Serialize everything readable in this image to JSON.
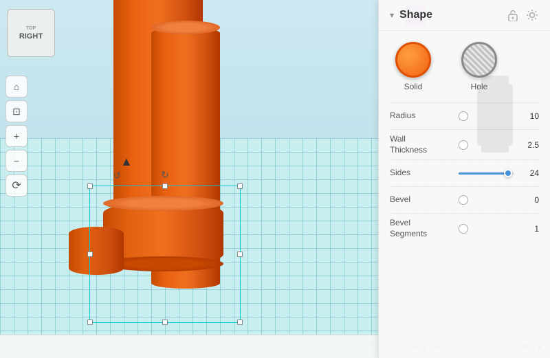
{
  "viewport": {
    "background_color": "#b8dde0"
  },
  "navcube": {
    "face_label": "RIGHT",
    "top_label": "TOP"
  },
  "toolbar": {
    "tools": [
      {
        "name": "home",
        "icon": "⌂"
      },
      {
        "name": "zoom-fit",
        "icon": "⊡"
      },
      {
        "name": "zoom-in",
        "icon": "+"
      },
      {
        "name": "zoom-out",
        "icon": "−"
      },
      {
        "name": "orbit",
        "icon": "↻"
      }
    ]
  },
  "bottom_bar": {
    "edit_grid_label": "Edit Grid",
    "snap_grid_label": "Snap Grid",
    "snap_grid_value": "0.5 mm ▴"
  },
  "right_panel": {
    "title": "Shape",
    "collapse_icon": "▾",
    "lock_icon": "🔓",
    "light_icon": "💡",
    "solid_label": "Solid",
    "hole_label": "Hole",
    "properties": [
      {
        "label": "Radius",
        "value": "10",
        "has_radio": true,
        "has_slider": false
      },
      {
        "label": "Wall\nThickness",
        "value": "2.5",
        "has_radio": true,
        "has_slider": false
      },
      {
        "label": "Sides",
        "value": "24",
        "has_radio": false,
        "has_slider": true,
        "fill_pct": 90
      },
      {
        "label": "Bevel",
        "value": "0",
        "has_radio": true,
        "has_slider": false
      },
      {
        "label": "Bevel\nSegments",
        "value": "1",
        "has_radio": true,
        "has_slider": false
      }
    ]
  }
}
